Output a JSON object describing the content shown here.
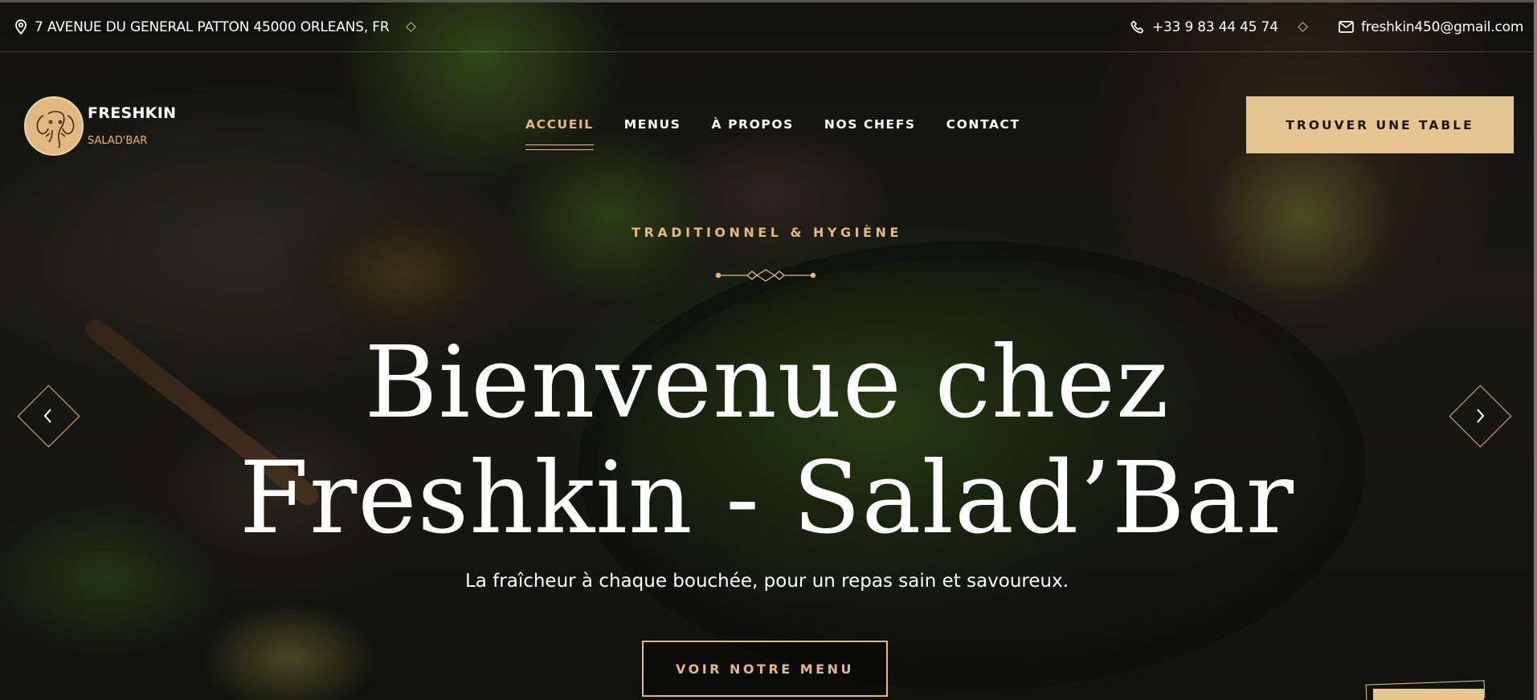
{
  "topbar": {
    "address": "7 AVENUE DU GENERAL PATTON 45000 ORLEANS, FR",
    "phone": "+33 9 83 44 45 74",
    "email": "freshkin450@gmail.com",
    "icons": [
      "location-pin-icon",
      "phone-icon",
      "mail-icon"
    ]
  },
  "brand": {
    "name": "FRESHKIN",
    "subtitle": "SALAD'BAR"
  },
  "nav": {
    "items": [
      {
        "label": "ACCUEIL",
        "active": true
      },
      {
        "label": "MENUS",
        "active": false
      },
      {
        "label": "À PROPOS",
        "active": false
      },
      {
        "label": "NOS CHEFS",
        "active": false
      },
      {
        "label": "CONTACT",
        "active": false
      }
    ],
    "cta": "TROUVER UNE TABLE"
  },
  "hero": {
    "eyebrow": "TRADITIONNEL & HYGIÈNE",
    "title_line1": "Bienvenue chez",
    "title_line2": "Freshkin - Salad’Bar",
    "subtitle": "La fraîcheur à chaque bouchée, pour un repas sain et savoureux.",
    "button": "VOIR NOTRE MENU"
  },
  "colors": {
    "accent": "#e3b97d",
    "cta_bg": "#e5c590",
    "text": "#ffffff"
  }
}
